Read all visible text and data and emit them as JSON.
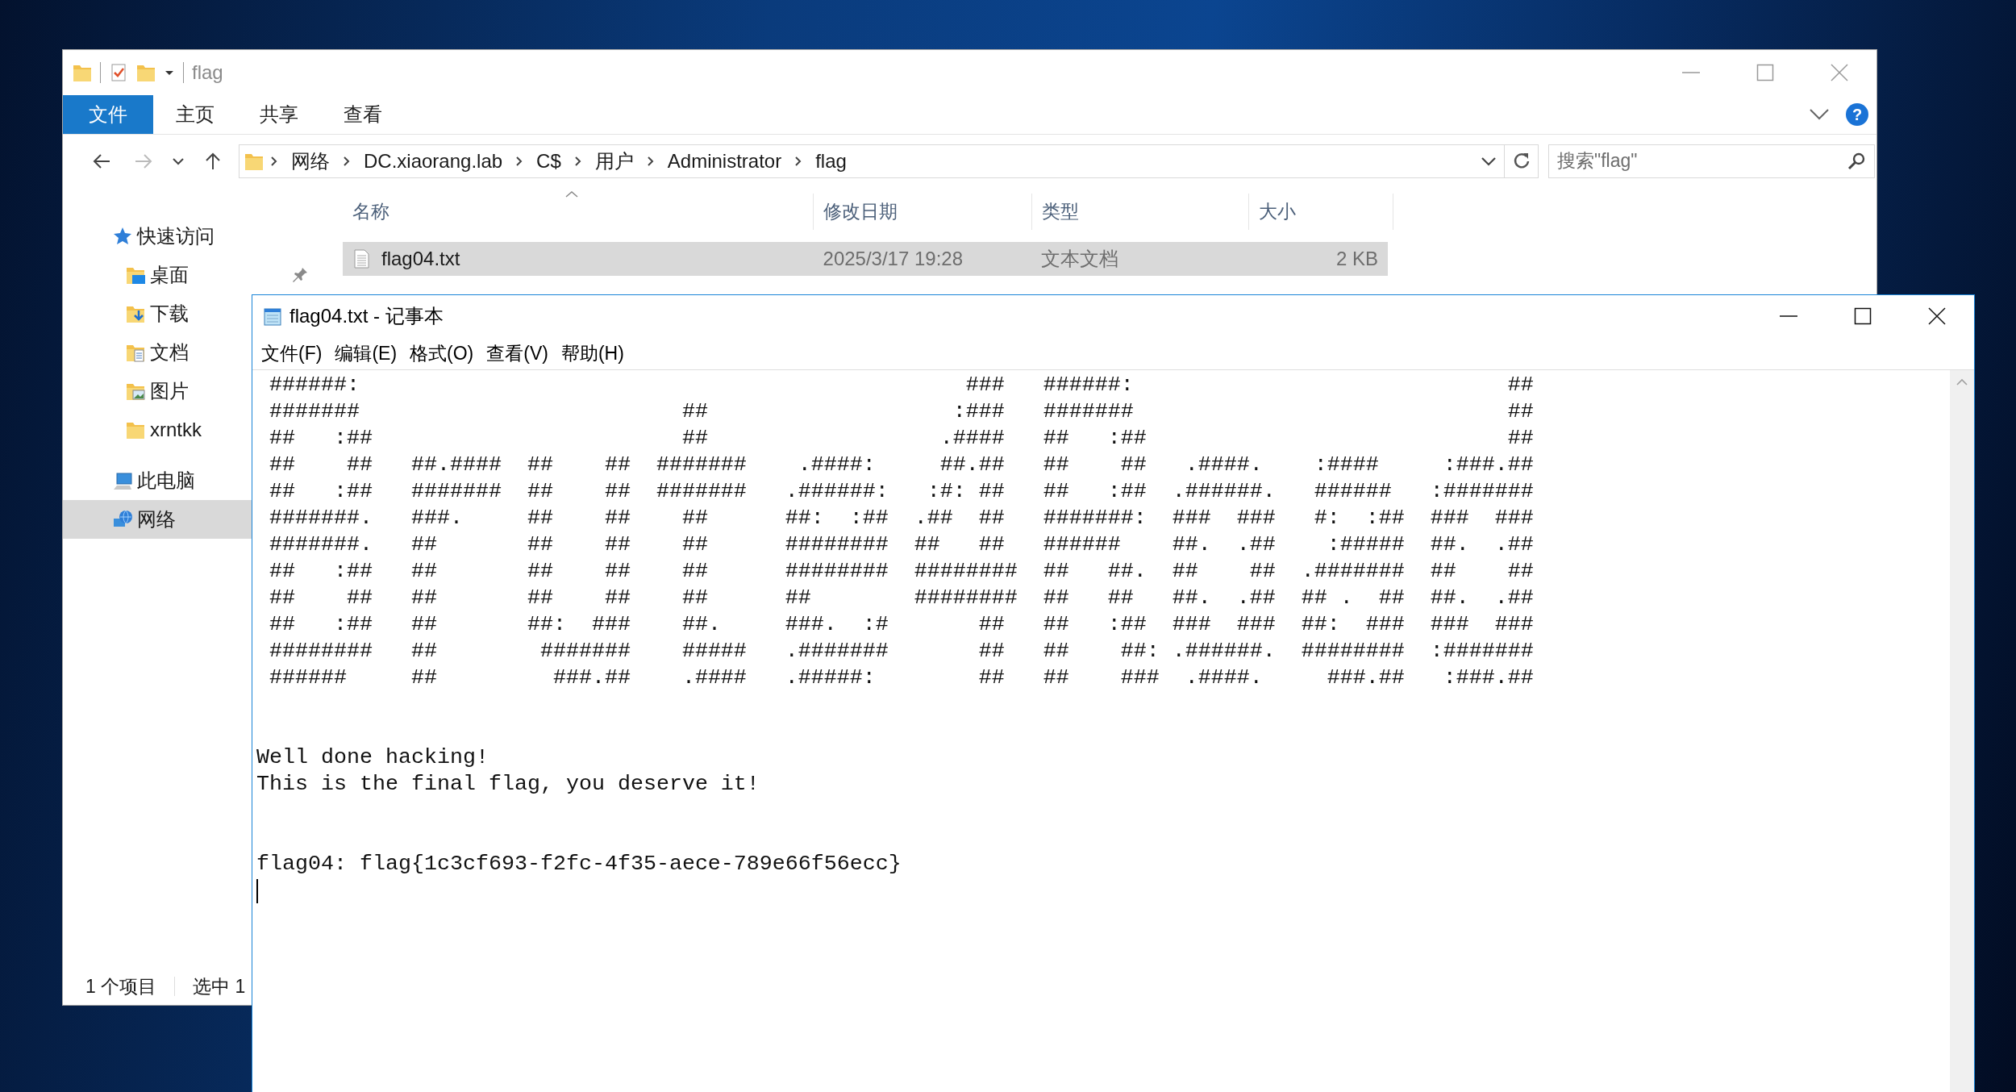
{
  "explorer": {
    "title": "flag",
    "ribbon_tabs": [
      {
        "label": "文件",
        "selected": true
      },
      {
        "label": "主页",
        "selected": false
      },
      {
        "label": "共享",
        "selected": false
      },
      {
        "label": "查看",
        "selected": false
      }
    ],
    "help_button": "?",
    "breadcrumb": [
      "网络",
      "DC.xiaorang.lab",
      "C$",
      "用户",
      "Administrator",
      "flag"
    ],
    "search": {
      "placeholder": "搜索\"flag\""
    },
    "nav": [
      {
        "label": "快速访问",
        "selected": false,
        "children": [
          {
            "label": "桌面",
            "selected": false,
            "pinned": true
          },
          {
            "label": "下载",
            "selected": false
          },
          {
            "label": "文档",
            "selected": false
          },
          {
            "label": "图片",
            "selected": false
          },
          {
            "label": "xrntkk",
            "selected": false
          }
        ]
      },
      {
        "label": "此电脑",
        "selected": false
      },
      {
        "label": "网络",
        "selected": true
      }
    ],
    "columns": [
      {
        "label": "名称",
        "sorted": true
      },
      {
        "label": "修改日期",
        "sorted": false
      },
      {
        "label": "类型",
        "sorted": false
      },
      {
        "label": "大小",
        "sorted": false
      }
    ],
    "files": [
      {
        "name": "flag04.txt",
        "modified": "2025/3/17 19:28",
        "type": "文本文档",
        "size": "2 KB",
        "selected": true
      }
    ],
    "status_bar": [
      "1 个项目",
      "选中 1"
    ]
  },
  "notepad": {
    "title": "flag04.txt - 记事本",
    "menu": [
      "文件(F)",
      "编辑(E)",
      "格式(O)",
      "查看(V)",
      "帮助(H)"
    ],
    "ascii_art": [
      "######:                                               ###   ######:                             ##",
      "#######                         ##                   :###   #######                             ##",
      "##   :##                        ##                  .####   ##   :##                            ##",
      "##    ##   ##.####  ##    ##  #######    .####:     ##.##   ##    ##   .####.    :####     :###.##",
      "##   :##   #######  ##    ##  #######   .######:   :#: ##   ##   :##  .######.   ######   :#######",
      "#######.   ###.     ##    ##    ##      ##:  :##  .##  ##   #######:  ###  ###   #:  :##  ###  ###",
      "#######.   ##       ##    ##    ##      ########  ##   ##   ######    ##.  .##    :#####  ##.  .##",
      "##   :##   ##       ##    ##    ##      ########  ########  ##   ##.  ##    ##  .#######  ##    ##",
      "##    ##   ##       ##    ##    ##      ##        ########  ##   ##   ##.  .##  ## .  ##  ##.  .##",
      "##   :##   ##       ##:  ###    ##.     ###.  :#       ##   ##   :##  ###  ###  ##:  ###  ###  ###",
      "########   ##        #######    #####   .#######       ##   ##    ##: .######.  ########  :#######",
      "######     ##         ###.##    .####   .#####:        ##   ##    ###  .####.     ###.##   :###.##"
    ],
    "message": [
      "Well done hacking!",
      "This is the final flag, you deserve it!"
    ],
    "flag_line": "flag04: flag{1c3cf693-f2fc-4f35-aece-789e66f56ecc}"
  }
}
